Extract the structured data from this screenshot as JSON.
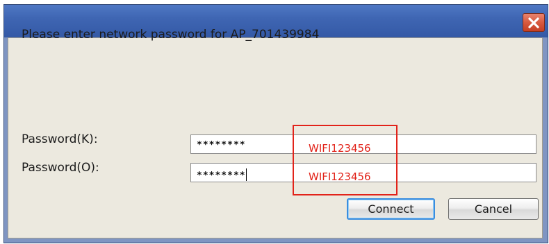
{
  "dialog": {
    "prompt": "Please enter network password for AP_701439984",
    "fields": [
      {
        "label": "Password(K):",
        "value": "********"
      },
      {
        "label": "Password(O):",
        "value": "********"
      }
    ],
    "buttons": {
      "connect": "Connect",
      "cancel": "Cancel"
    },
    "close_icon": "close-icon"
  },
  "annotation": {
    "color": "#e2231a",
    "texts": [
      "WIFI123456",
      "WIFI123456"
    ]
  }
}
